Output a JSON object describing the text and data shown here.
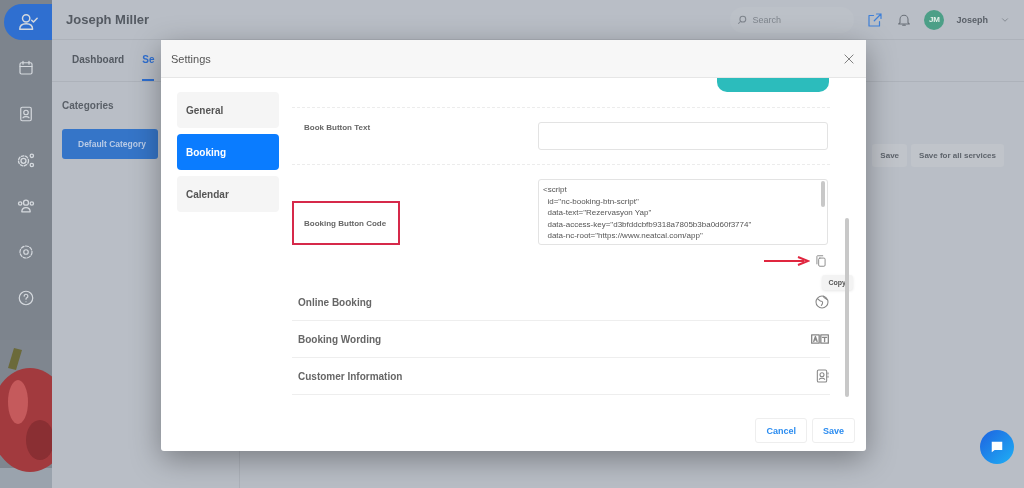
{
  "topbar": {
    "title": "Joseph Miller",
    "search": {
      "placeholder": "Search"
    },
    "avatar": "JM",
    "user": "Joseph"
  },
  "sidebar": {
    "items": [
      {
        "selected": true
      },
      {
        "selected": false
      },
      {
        "selected": false
      },
      {
        "selected": false
      },
      {
        "selected": false
      },
      {
        "selected": false
      },
      {
        "selected": false
      }
    ]
  },
  "tabs": [
    {
      "label": "Dashboard",
      "selected": false
    },
    {
      "label": "Se",
      "selected": true
    }
  ],
  "categories": {
    "title": "Categories",
    "items": [
      {
        "label": "Default Category",
        "selected": true
      }
    ]
  },
  "service_actions": [
    "Save",
    "Save for all services"
  ],
  "dialog": {
    "title": "Settings",
    "nav": [
      {
        "label": "General",
        "selected": false
      },
      {
        "label": "Booking",
        "selected": true
      },
      {
        "label": "Calendar",
        "selected": false
      }
    ],
    "book_button_text": {
      "label": "Book Button Text"
    },
    "booking_button_code": {
      "label": "Booking Button Code",
      "highlighted": true,
      "code": [
        "<script",
        "  id=\"nc-booking-btn-script\"",
        "  data-text=\"Rezervasyon Yap\"",
        "  data-access-key=\"d3bfddcbfb9318a7805b3ba0d60f3774\"",
        "  data-nc-root=\"https://www.neatcal.com/app\""
      ],
      "tooltip": "Copy"
    },
    "sections": [
      {
        "label": "Online Booking"
      },
      {
        "label": "Booking Wording"
      },
      {
        "label": "Customer Information"
      }
    ],
    "buttons": [
      "Cancel",
      "Save"
    ]
  }
}
